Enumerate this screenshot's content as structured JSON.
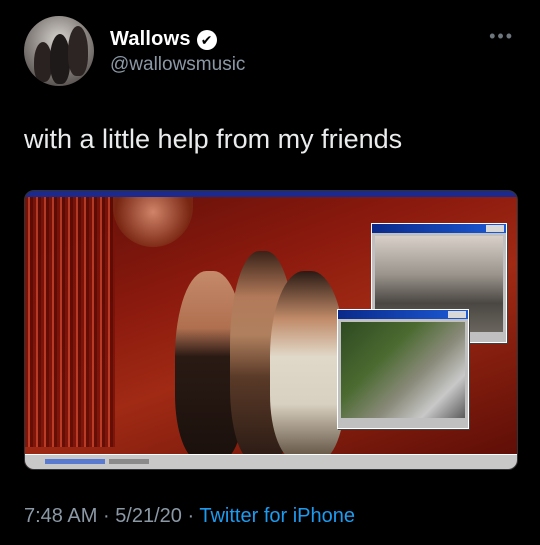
{
  "user": {
    "display_name": "Wallows",
    "handle": "@wallowsmusic",
    "verified_glyph": "✔"
  },
  "more_glyph": "•••",
  "tweet": {
    "text": "with a little help from my friends",
    "time": "7:48 AM",
    "separator": "·",
    "date": "5/21/20",
    "source": "Twitter for iPhone"
  },
  "colors": {
    "background": "#000000",
    "secondary_text": "#8b98a5",
    "link": "#1d9bf0"
  },
  "icons": {
    "verified": "verified-badge-icon",
    "more": "more-options-icon"
  }
}
